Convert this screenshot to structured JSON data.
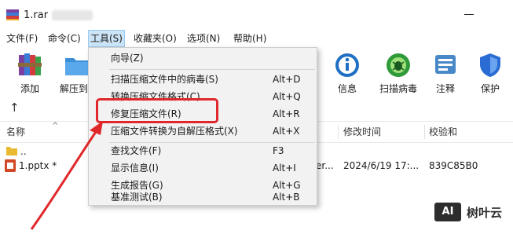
{
  "window": {
    "title": "1.rar"
  },
  "menubar": [
    "文件(F)",
    "命令(C)",
    "工具(S)",
    "收藏夹(O)",
    "选项(N)",
    "帮助(H)"
  ],
  "toolbar": {
    "items": [
      {
        "label": "添加",
        "icon": "archive-books-icon"
      },
      {
        "label": "解压到",
        "icon": "folder-icon"
      },
      {
        "label": "信息",
        "icon": "info-icon"
      },
      {
        "label": "扫描病毒",
        "icon": "virus-scan-icon"
      },
      {
        "label": "注释",
        "icon": "comment-icon"
      },
      {
        "label": "保护",
        "icon": "shield-icon"
      }
    ]
  },
  "filelist": {
    "columns": [
      "名称",
      "修改时间",
      "校验和"
    ],
    "rows": [
      {
        "name": "..",
        "type": "",
        "modified": "",
        "checksum": ""
      },
      {
        "name": "1.pptx *",
        "type": "er...",
        "modified": "2024/6/19 17:...",
        "checksum": "839C85B0"
      }
    ]
  },
  "tools_menu": {
    "items": [
      {
        "label": "向导(Z)",
        "shortcut": ""
      },
      {
        "label": "扫描压缩文件中的病毒(S)",
        "shortcut": "Alt+D"
      },
      {
        "label": "转换压缩文件格式(C)",
        "shortcut": "Alt+Q"
      },
      {
        "label": "修复压缩文件(R)",
        "shortcut": "Alt+R"
      },
      {
        "label": "压缩文件转换为自解压格式(X)",
        "shortcut": "Alt+X"
      },
      {
        "label": "查找文件(F)",
        "shortcut": "F3"
      },
      {
        "label": "显示信息(I)",
        "shortcut": "Alt+I"
      },
      {
        "label": "生成报告(G)",
        "shortcut": "Alt+G"
      },
      {
        "label": "基准测试(B)",
        "shortcut": "Alt+B"
      }
    ],
    "highlighted": "修复压缩文件(R)"
  },
  "annotation": {
    "color": "#e0282b"
  },
  "watermark": {
    "badge": "AI",
    "text": "树叶云"
  }
}
